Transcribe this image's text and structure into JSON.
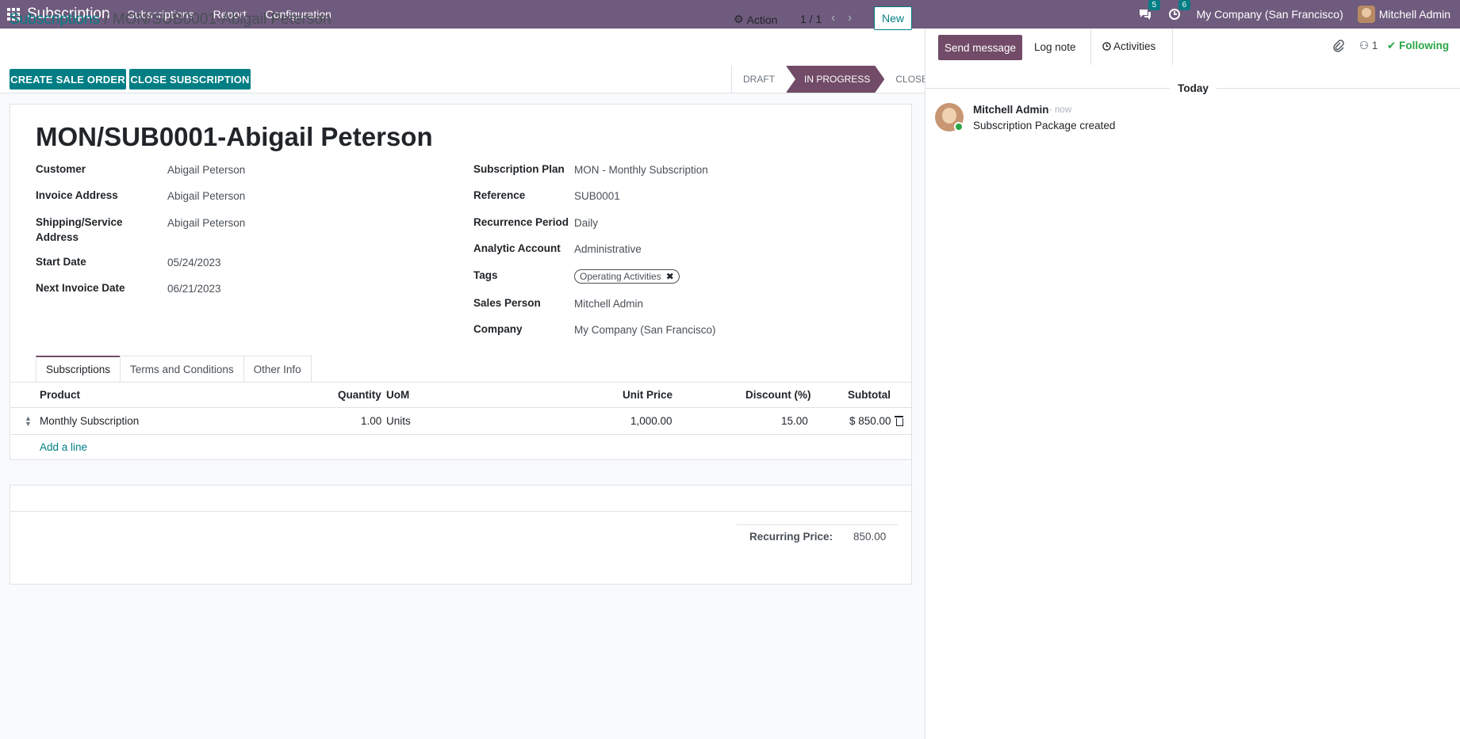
{
  "topbar": {
    "app_name": "Subscription",
    "menu": [
      "Subscriptions",
      "Report",
      "Configuration"
    ],
    "messages_count": "5",
    "activities_count": "6",
    "company": "My Company (San Francisco)",
    "user": "Mitchell Admin"
  },
  "control_panel": {
    "breadcrumb_parent": "Subscriptions",
    "breadcrumb_sep": "/",
    "breadcrumb_current": "MON/SUB0001-Abigail Peterson",
    "action_label": "Action",
    "pager": "1 / 1",
    "new_label": "New",
    "create_sale_order": "CREATE SALE ORDER",
    "close_subscription": "CLOSE SUBSCRIPTION",
    "statuses": [
      "DRAFT",
      "IN PROGRESS",
      "CLOSED"
    ],
    "active_status": "IN PROGRESS"
  },
  "form": {
    "title": "MON/SUB0001-Abigail Peterson",
    "left": {
      "customer_label": "Customer",
      "customer": "Abigail Peterson",
      "invoice_label": "Invoice Address",
      "invoice": "Abigail Peterson",
      "shipping_label_1": "Shipping/Service",
      "shipping_label_2": "Address",
      "shipping": "Abigail Peterson",
      "start_label": "Start Date",
      "start": "05/24/2023",
      "next_label": "Next Invoice Date",
      "next": "06/21/2023"
    },
    "right": {
      "plan_label": "Subscription Plan",
      "plan": "MON - Monthly Subscription",
      "reference_label": "Reference",
      "reference": "SUB0001",
      "recurrence_label": "Recurrence Period",
      "recurrence": "Daily",
      "analytic_label": "Analytic Account",
      "analytic": "Administrative",
      "tags_label": "Tags",
      "tag": "Operating Activities",
      "salesperson_label": "Sales Person",
      "salesperson": "Mitchell Admin",
      "company_label": "Company",
      "company": "My Company (San Francisco)"
    },
    "tabs": [
      "Subscriptions",
      "Terms and Conditions",
      "Other Info"
    ],
    "table": {
      "headers": [
        "Product",
        "Quantity",
        "UoM",
        "Unit Price",
        "Discount (%)",
        "Subtotal"
      ],
      "rows": [
        {
          "product": "Monthly Subscription",
          "quantity": "1.00",
          "uom": "Units",
          "unit_price": "1,000.00",
          "discount": "15.00",
          "subtotal": "$ 850.00"
        }
      ],
      "add_line": "Add a line"
    },
    "totals": {
      "label": "Recurring Price:",
      "value": "850.00"
    }
  },
  "chatter": {
    "send_message": "Send message",
    "log_note": "Log note",
    "activities": "Activities",
    "followers_count": "1",
    "following": "Following",
    "date_separator": "Today",
    "messages": [
      {
        "author": "Mitchell Admin",
        "time": "- now",
        "body": "Subscription Package created"
      }
    ]
  },
  "colors": {
    "topbar": "#6f5b7d",
    "primary": "#017e84",
    "accent": "#714b67"
  }
}
